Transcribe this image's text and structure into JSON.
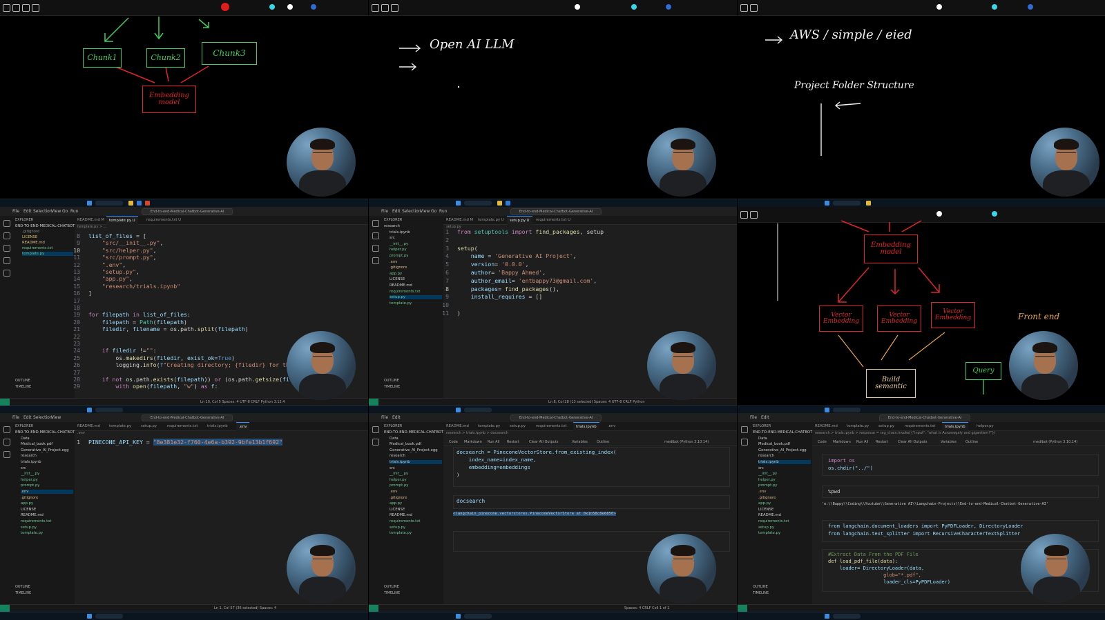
{
  "board1": {
    "chunks": [
      "Chunk1",
      "Chunk2",
      "Chunk3"
    ],
    "embedding_box": "Embedding model"
  },
  "board2": {
    "lines": [
      "Open AI  LLM",
      ""
    ]
  },
  "board3": {
    "line1": "AWS  /  simple  / eied",
    "line2": "Project  Folder  Structure"
  },
  "editor_setup_file": {
    "lines": [
      {
        "n": "1",
        "tokens": [
          [
            "kw",
            "from "
          ],
          [
            "cls",
            "setuptools "
          ],
          [
            "kw",
            "import "
          ],
          [
            "fn",
            "find_packages"
          ],
          [
            "",
            ""
          ],
          [
            "",
            ", setup"
          ]
        ]
      },
      {
        "n": "2",
        "tokens": []
      },
      {
        "n": "3",
        "tokens": [
          [
            "fn",
            "setup"
          ],
          [
            "",
            "("
          ]
        ]
      },
      {
        "n": "4",
        "tokens": [
          [
            "var",
            "    name "
          ],
          [
            "",
            "= "
          ],
          [
            "str",
            "'Generative AI Project'"
          ],
          [
            "",
            ","
          ]
        ]
      },
      {
        "n": "5",
        "tokens": [
          [
            "var",
            "    version"
          ],
          [
            "",
            "= "
          ],
          [
            "str",
            "'0.0.0'"
          ],
          [
            "",
            ","
          ]
        ]
      },
      {
        "n": "6",
        "tokens": [
          [
            "var",
            "    author"
          ],
          [
            "",
            "= "
          ],
          [
            "str",
            "'Bappy Ahmed'"
          ],
          [
            "",
            ","
          ]
        ]
      },
      {
        "n": "7",
        "tokens": [
          [
            "var",
            "    author_email"
          ],
          [
            "",
            "= "
          ],
          [
            "str",
            "'entbappy73@gmail.com'"
          ],
          [
            "",
            ","
          ]
        ]
      },
      {
        "n": "8",
        "tokens": [
          [
            "var",
            "    packages"
          ],
          [
            "",
            "= "
          ],
          [
            "fn",
            "find_packages"
          ],
          [
            "",
            "(),"
          ]
        ]
      },
      {
        "n": "9",
        "tokens": [
          [
            "var",
            "    install_requires "
          ],
          [
            "",
            "= []"
          ]
        ]
      },
      {
        "n": "10",
        "tokens": [
          [
            "",
            "    "
          ]
        ]
      },
      {
        "n": "11",
        "tokens": [
          [
            "",
            ")"
          ]
        ]
      }
    ]
  },
  "editor_template_file": {
    "lines": [
      {
        "n": "8",
        "tokens": [
          [
            "var",
            "list_of_files "
          ],
          [
            "",
            "= ["
          ]
        ]
      },
      {
        "n": "9",
        "tokens": [
          [
            "str",
            "    \"src/__init__.py\""
          ],
          [
            "",
            ","
          ]
        ]
      },
      {
        "n": "10",
        "tokens": [
          [
            "str",
            "    \"src/helper.py\""
          ],
          [
            "",
            ","
          ]
        ]
      },
      {
        "n": "11",
        "tokens": [
          [
            "str",
            "    \"src/prompt.py\""
          ],
          [
            "",
            ","
          ]
        ]
      },
      {
        "n": "12",
        "tokens": [
          [
            "str",
            "    \".env\""
          ],
          [
            "",
            ","
          ]
        ]
      },
      {
        "n": "13",
        "tokens": [
          [
            "str",
            "    \"setup.py\""
          ],
          [
            "",
            ","
          ]
        ]
      },
      {
        "n": "14",
        "tokens": [
          [
            "str",
            "    \"app.py\""
          ],
          [
            "",
            ","
          ]
        ]
      },
      {
        "n": "15",
        "tokens": [
          [
            "str",
            "    \"research/trials.ipynb\""
          ]
        ]
      },
      {
        "n": "16",
        "tokens": [
          [
            "",
            "]"
          ]
        ]
      },
      {
        "n": "17",
        "tokens": []
      },
      {
        "n": "18",
        "tokens": []
      },
      {
        "n": "19",
        "tokens": [
          [
            "kw",
            "for "
          ],
          [
            "var",
            "filepath "
          ],
          [
            "kw",
            "in "
          ],
          [
            "var",
            "list_of_files"
          ],
          [
            "",
            ":"
          ]
        ]
      },
      {
        "n": "20",
        "tokens": [
          [
            "var",
            "    filepath "
          ],
          [
            "",
            "= "
          ],
          [
            "cls",
            "Path"
          ],
          [
            "",
            "("
          ],
          [
            "var",
            "filepath"
          ],
          [
            "",
            ")"
          ]
        ]
      },
      {
        "n": "21",
        "tokens": [
          [
            "var",
            "    filedir, filename "
          ],
          [
            "",
            "= os.path."
          ],
          [
            "fn",
            "split"
          ],
          [
            "",
            "("
          ],
          [
            "var",
            "filepath"
          ],
          [
            "",
            ")"
          ]
        ]
      },
      {
        "n": "22",
        "tokens": []
      },
      {
        "n": "23",
        "tokens": []
      },
      {
        "n": "24",
        "tokens": [
          [
            "kw",
            "    if "
          ],
          [
            "var",
            "filedir "
          ],
          [
            "",
            "!="
          ],
          [
            "str",
            "\"\""
          ],
          [
            "",
            ":"
          ]
        ]
      },
      {
        "n": "25",
        "tokens": [
          [
            "",
            "        os."
          ],
          [
            "fn",
            "makedirs"
          ],
          [
            "",
            "("
          ],
          [
            "var",
            "filedir"
          ],
          [
            "",
            ", "
          ],
          [
            "var",
            "exist_ok"
          ],
          [
            "",
            "="
          ],
          [
            "bi",
            "True"
          ],
          [
            "",
            ")"
          ]
        ]
      },
      {
        "n": "26",
        "tokens": [
          [
            "",
            "        logging."
          ],
          [
            "fn",
            "info"
          ],
          [
            "",
            "("
          ],
          [
            "bi",
            "f"
          ],
          [
            "str",
            "\"Creating directory; {filedir} for the file: {"
          ]
        ]
      },
      {
        "n": "27",
        "tokens": []
      },
      {
        "n": "28",
        "tokens": [
          [
            "kw",
            "    if not "
          ],
          [
            "",
            "os.path."
          ],
          [
            "fn",
            "exists"
          ],
          [
            "",
            "("
          ],
          [
            "var",
            "filepath"
          ],
          [
            "",
            ")) "
          ],
          [
            "kw",
            "or "
          ],
          [
            "",
            "(os.path."
          ],
          [
            "fn",
            "getsize"
          ],
          [
            "",
            "("
          ],
          [
            "var",
            "filepath"
          ],
          [
            "",
            ")"
          ]
        ]
      },
      {
        "n": "29",
        "tokens": [
          [
            "kw",
            "        with "
          ],
          [
            "fn",
            "open"
          ],
          [
            "",
            "("
          ],
          [
            "var",
            "filepath"
          ],
          [
            "",
            ", "
          ],
          [
            "str",
            "\"w\""
          ],
          [
            "",
            ") "
          ],
          [
            "kw",
            "as "
          ],
          [
            "var",
            "f"
          ],
          [
            "",
            ":"
          ]
        ]
      }
    ]
  },
  "env_file": {
    "key": "PINECONE_API_KEY",
    "value": "\"8e381e32-f760-4e6a-b392-9bfe13b1f692\""
  },
  "notebook_cell": {
    "lines": [
      "docsearch = PineconeVectorStore.from_existing_index(",
      "    index_name=index_name,",
      "    embedding=embeddings",
      ")"
    ],
    "cell2": "docsearch",
    "output": "<langchain_pinecone.vectorstores.PineconeVectorStore at 0x1b58c8e6850>"
  },
  "board4": {
    "top_box": "Embedding model",
    "vector_boxes": [
      "Vector Embedding",
      "Vector Embedding",
      "Vector Embedding"
    ],
    "front_end": "Front end",
    "query": "Query",
    "build": "Build semantic"
  },
  "notebook_load": {
    "c1": [
      "import os",
      "os.chdir(\"../\")"
    ],
    "c2": "%pwd",
    "c2_out": "'e:\\\\Bappy\\\\Coding\\\\Youtube\\\\Generative AI\\\\Langchain-Projects\\\\End-to-end-Medical-Chatbot-Generative-AI'",
    "c3": [
      "from langchain.document_loaders import PyPDFLoader, DirectoryLoader",
      "from langchain.text_splitter import RecursiveCharacterTextSplitter"
    ],
    "c4": [
      "#Extract Data From the PDF File",
      "def load_pdf_file(data):",
      "    loader= DirectoryLoader(data,",
      "                   glob=\"*.pdf\",",
      "                   loader_cls=PyPDFLoader)"
    ]
  },
  "vscode": {
    "menu": [
      "File",
      "Edit",
      "Selection",
      "View",
      "Go",
      "Run",
      "..."
    ],
    "command": "End-to-end-Medical-Chatbot-Generative-AI",
    "explorer_title": "EXPLORER",
    "outline": "OUTLINE",
    "timeline": "TIMELINE"
  },
  "explorer_a": [
    "END-TO-END-MEDICAL-CHATBOT",
    ".gitignore",
    "LICENSE",
    "README.md",
    "requirements.txt",
    "template.py"
  ],
  "explorer_b": [
    "research",
    "trials.ipynb",
    "src",
    "__init__.py",
    "helper.py",
    "prompt.py",
    ".env",
    ".gitignore",
    "app.py",
    "LICENSE",
    "README.md",
    "requirements.txt",
    "setup.py",
    "template.py"
  ],
  "explorer_c": [
    "END-TO-END-MEDICAL-CHATBOT-GE...",
    "Data",
    "Medical_book.pdf",
    "Generative_AI_Project.egg",
    "research",
    "trials.ipynb",
    "src",
    "__init__.py",
    "helper.py",
    "prompt.py",
    ".env",
    ".gitignore",
    "app.py",
    "LICENSE",
    "README.md",
    "requirements.txt",
    "setup.py",
    "template.py"
  ],
  "tabs": {
    "template_editor": [
      "README.md M",
      "template.py U",
      "requirements.txt U"
    ],
    "setup_editor": [
      "README.md M",
      "template.py U",
      "setup.py U",
      "requirements.txt U"
    ],
    "env_editor": [
      "README.md",
      "template.py",
      "setup.py",
      "requirements.txt",
      "trials.ipynb",
      ".env"
    ],
    "nb_editor": [
      "README.md",
      "template.py",
      "setup.py",
      "requirements.txt",
      "trials.ipynb",
      ".env"
    ],
    "nb2_editor": [
      "README.md",
      "template.py",
      "setup.py",
      "requirements.txt",
      "trials.ipynb",
      "helper.py"
    ]
  },
  "breadcrumbs": {
    "template": "template.py > ...",
    "setup": "setup.py",
    "env": ".env",
    "nb": "research > trials.ipynb > docsearch",
    "nb2": "research > trials.ipynb > response = rag_chain.invoke({\"input\": \"what is Acromegaly and gigantism?\"})"
  },
  "nb_toolbar": [
    "Code",
    "Markdown",
    "Run All",
    "Restart",
    "Clear All Outputs",
    "Variables",
    "Outline"
  ],
  "kernel": "medibot (Python 3.10.14)",
  "status": {
    "template": "Ln 10, Col 5   Spaces: 4   UTF-8   CRLF   Python   3.12.4",
    "setup": "Ln 8, Col 28 (13 selected)   Spaces: 4   UTF-8   CRLF   Python",
    "env": "Ln 1, Col 57 (36 selected)   Spaces: 4",
    "nb": "Spaces: 4   CRLF   Cell 1 of 1"
  }
}
